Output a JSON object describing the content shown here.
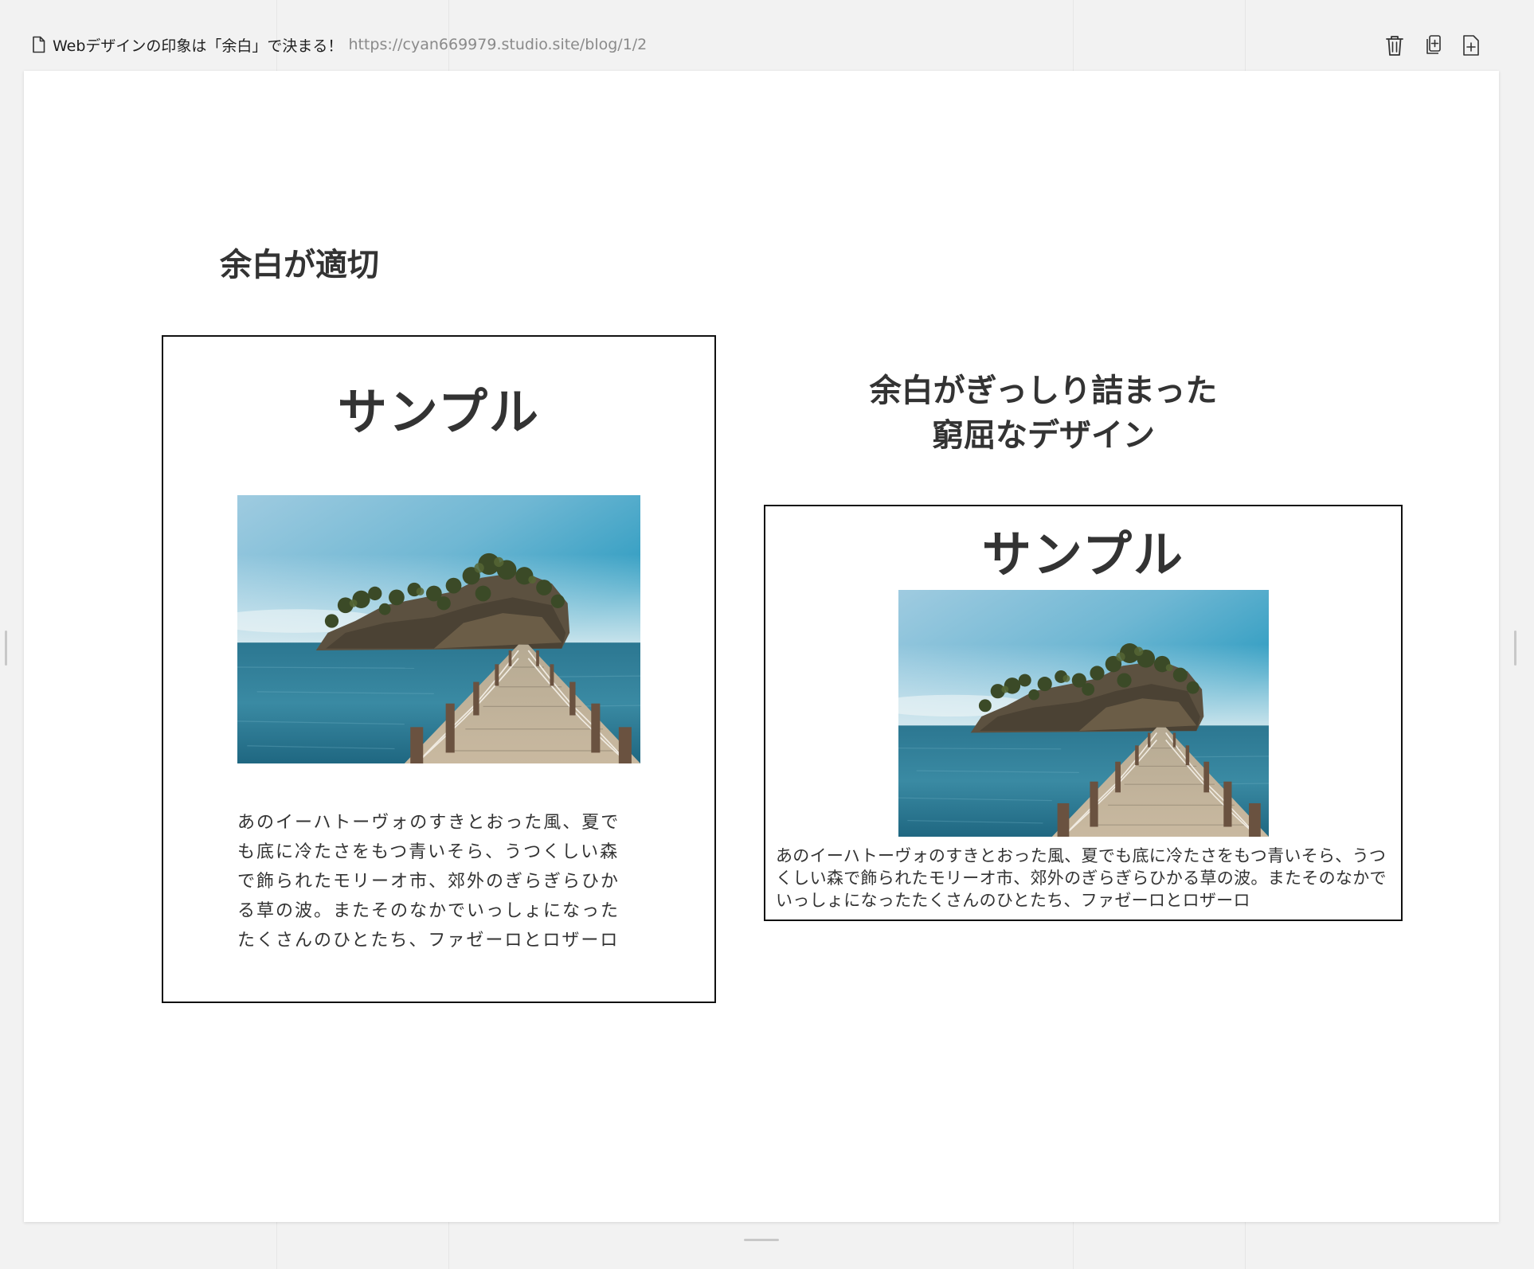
{
  "topbar": {
    "page_name": "Webデザインの印象は「余白」で決まる！",
    "page_url": "https://cyan669979.studio.site/blog/1/2",
    "actions": {
      "delete": "trash-icon",
      "duplicate": "duplicate-page-icon",
      "add": "add-page-icon"
    }
  },
  "left": {
    "heading": "余白が適切",
    "card_title": "サンプル",
    "card_text": "あのイーハトーヴォのすきとおった風、夏でも底に冷たさをもつ青いそら、うつくしい森で飾られたモリーオ市、郊外のぎらぎらひかる草の波。またそのなかでいっしょになったたくさんのひとたち、ファゼーロとロザーロ"
  },
  "right": {
    "heading_line1": "余白がぎっしり詰まった",
    "heading_line2": "窮屈なデザイン",
    "card_title": "サンプル",
    "card_text": "あのイーハトーヴォのすきとおった風、夏でも底に冷たさをもつ青いそら、うつくしい森で飾られたモリーオ市、郊外のぎらぎらひかる草の波。またそのなかでいっしょになったたくさんのひとたち、ファゼーロとロザーロ"
  },
  "colors": {
    "canvas_bg": "#f2f2f2",
    "page_bg": "#ffffff",
    "text": "#333333",
    "border": "#111111",
    "url": "#8a8a8a"
  }
}
